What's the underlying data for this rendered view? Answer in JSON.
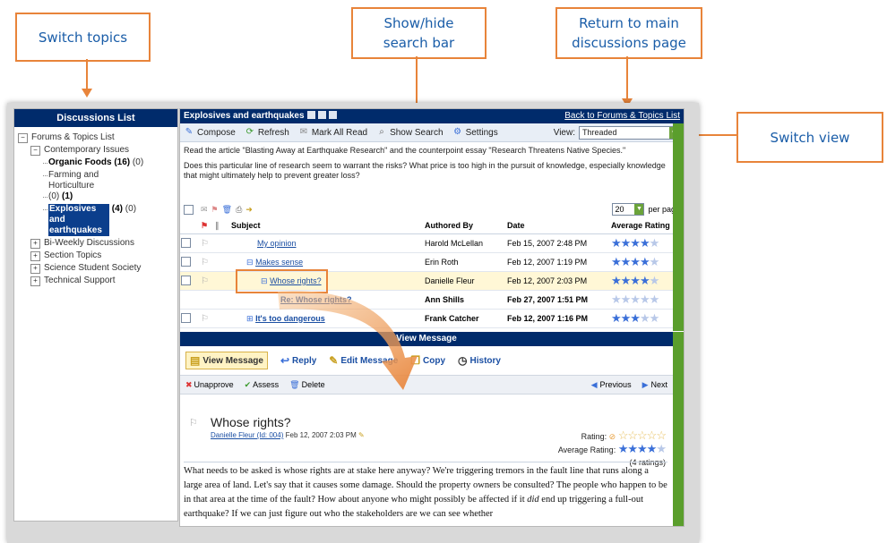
{
  "callouts": {
    "switch_topics": "Switch topics",
    "show_hide_1": "Show/hide",
    "show_hide_2": "search bar",
    "return_1": "Return to main",
    "return_2": "discussions page",
    "switch_view": "Switch view"
  },
  "sidebar": {
    "title": "Discussions List",
    "items": [
      {
        "label": "Forums & Topics List"
      },
      {
        "label": "Contemporary Issues"
      },
      {
        "label": "Organic Foods",
        "count": "(16)",
        "extra": "(0)"
      },
      {
        "label": "Farming and Horticulture",
        "count": "(0)",
        "extra": "(1)"
      },
      {
        "label": "Explosives and earthquakes",
        "count": "(4)",
        "extra": "(0)"
      },
      {
        "label": "Bi-Weekly Discussions"
      },
      {
        "label": "Section Topics"
      },
      {
        "label": "Science Student Society"
      },
      {
        "label": "Technical Support"
      }
    ]
  },
  "topic": {
    "title": "Explosives and earthquakes",
    "back_link": "Back to Forums & Topics List"
  },
  "toolbar": {
    "compose": "Compose",
    "refresh": "Refresh",
    "mark_all_read": "Mark All Read",
    "show_search": "Show Search",
    "settings": "Settings",
    "view_label": "View:",
    "view_value": "Threaded"
  },
  "description": {
    "p1": "Read the article \"Blasting Away at Earthquake Research\" and the counterpoint essay \"Research Threatens Native Species.\"",
    "p2": "Does this particular line of research seem to warrant the risks? What price is too high in the pursuit of knowledge, especially knowledge that might ultimately help to prevent greater loss?"
  },
  "per_page": {
    "value": "20",
    "label": "per page"
  },
  "table": {
    "headers": [
      "Subject",
      "Authored By",
      "Date",
      "Average Rating"
    ],
    "rows": [
      {
        "subject": "My opinion",
        "author": "Harold McLellan",
        "date": "Feb 15, 2007 2:48 PM",
        "rating": 4.5
      },
      {
        "subject": "Makes sense",
        "author": "Erin Roth",
        "date": "Feb 12, 2007 1:19 PM",
        "rating": 4
      },
      {
        "subject": "Whose rights?",
        "author": "Danielle Fleur",
        "date": "Feb 12, 2007 2:03 PM",
        "rating": 4
      },
      {
        "subject": "Re: Whose rights?",
        "author": "Ann Shills",
        "date": "Feb 27, 2007 1:51 PM",
        "rating": 0
      },
      {
        "subject": "It's too dangerous",
        "author": "Frank Catcher",
        "date": "Feb 12, 2007 1:16 PM",
        "rating": 3
      }
    ]
  },
  "message": {
    "bar_title": "View Message",
    "tabs": {
      "view": "View Message",
      "reply": "Reply",
      "edit": "Edit Message",
      "copy": "Copy",
      "history": "History"
    },
    "actions": {
      "unapprove": "Unapprove",
      "assess": "Assess",
      "delete": "Delete",
      "previous": "Previous",
      "next": "Next"
    },
    "title": "Whose rights?",
    "author_link": "Danielle Fleur (Id: 004)",
    "date": "Feb 12, 2007 2:03 PM",
    "rating_label": "Rating:",
    "avg_rating_label": "Average Rating:",
    "ratings_count": "(4 ratings)",
    "body_1": "What needs to be asked is whose rights are at stake here anyway? We're triggering tremors in the fault line that runs along a large area of land. Let's say that it causes some damage. Should the property owners be consulted? The people who happen to be in that area at the time of the fault? How about anyone who might possibly be affected if it",
    "body_em": "did",
    "body_2": "end up triggering a full-out earthquake? If we can just figure out who the stakeholders are we can see whether"
  },
  "colors": {
    "accent": "#e8843a",
    "header": "#002b6b",
    "link": "#1b4fa3",
    "star": "#3a6fd8"
  }
}
